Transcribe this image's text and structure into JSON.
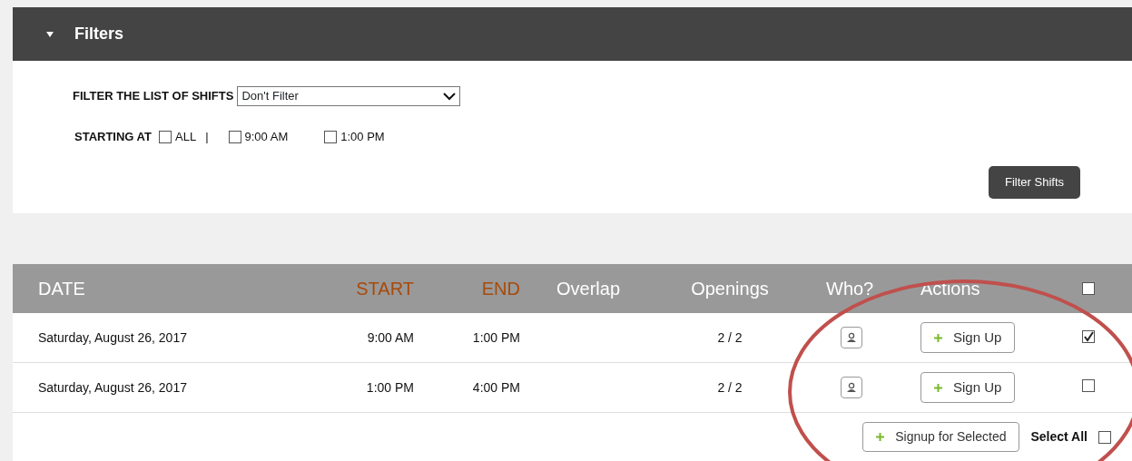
{
  "filters_panel": {
    "title": "Filters",
    "expanded": true
  },
  "filter_field": {
    "label": "FILTER THE LIST OF SHIFTS",
    "value": "Don't Filter"
  },
  "starting_at": {
    "label": "STARTING AT",
    "separator": "|",
    "options": [
      {
        "label": "ALL",
        "checked": false
      },
      {
        "label": "9:00 AM",
        "checked": false
      },
      {
        "label": "1:00 PM",
        "checked": false
      }
    ]
  },
  "filter_button": "Filter Shifts",
  "table": {
    "columns": [
      {
        "label": "DATE",
        "color": "#ffffff"
      },
      {
        "label": "START",
        "color": "#a84a0a"
      },
      {
        "label": "END",
        "color": "#a84a0a"
      },
      {
        "label": "Overlap",
        "color": "#ffffff"
      },
      {
        "label": "Openings",
        "color": "#ffffff"
      },
      {
        "label": "Who?",
        "color": "#ffffff"
      },
      {
        "label": "Actions",
        "color": "#ffffff"
      }
    ],
    "header_checked": false,
    "rows": [
      {
        "date": "Saturday, August 26, 2017",
        "start": "9:00 AM",
        "end": "1:00 PM",
        "openings": "2 / 2",
        "action": "Sign Up",
        "checked": true
      },
      {
        "date": "Saturday, August 26, 2017",
        "start": "1:00 PM",
        "end": "4:00 PM",
        "openings": "2 / 2",
        "action": "Sign Up",
        "checked": false
      }
    ]
  },
  "footer": {
    "button": "Signup for Selected",
    "select_all_label": "Select All",
    "select_all_checked": false
  }
}
